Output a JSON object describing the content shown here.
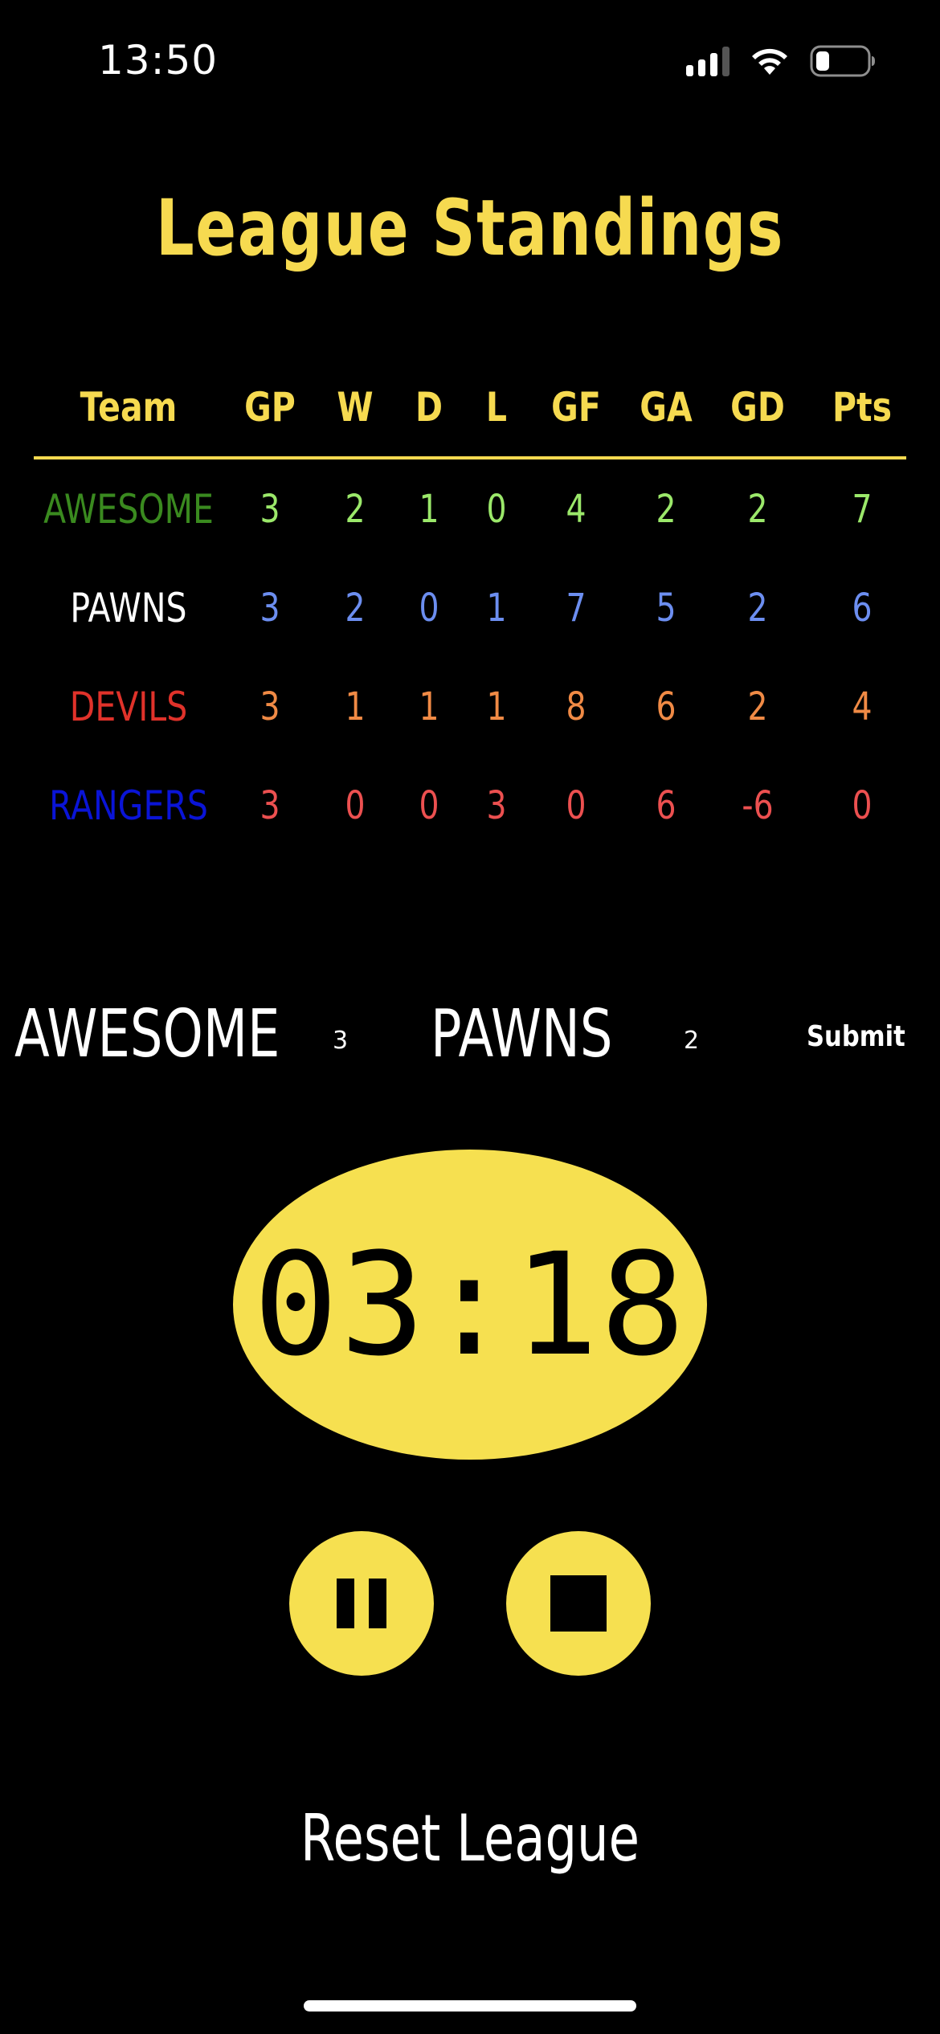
{
  "status_bar": {
    "time": "13:50",
    "icons": [
      "cellular-signal-icon",
      "wifi-icon",
      "battery-icon"
    ]
  },
  "page": {
    "title": "League Standings"
  },
  "standings": {
    "headers": {
      "team": "Team",
      "gp": "GP",
      "w": "W",
      "d": "D",
      "l": "L",
      "gf": "GF",
      "ga": "GA",
      "gd": "GD",
      "pts": "Pts"
    },
    "accent_color": "#f6da50",
    "rows": [
      {
        "team": "AWESOME",
        "gp": "3",
        "w": "2",
        "d": "1",
        "l": "0",
        "gf": "4",
        "ga": "2",
        "gd": "2",
        "pts": "7",
        "team_color": "#3a8a1f",
        "stat_color": "#9be86a"
      },
      {
        "team": "PAWNS",
        "gp": "3",
        "w": "2",
        "d": "0",
        "l": "1",
        "gf": "7",
        "ga": "5",
        "gd": "2",
        "pts": "6",
        "team_color": "#ffffff",
        "stat_color": "#6c8ef0"
      },
      {
        "team": "DEVILS",
        "gp": "3",
        "w": "1",
        "d": "1",
        "l": "1",
        "gf": "8",
        "ga": "6",
        "gd": "2",
        "pts": "4",
        "team_color": "#e0322a",
        "stat_color": "#f08a45"
      },
      {
        "team": "RANGERS",
        "gp": "3",
        "w": "0",
        "d": "0",
        "l": "3",
        "gf": "0",
        "ga": "6",
        "gd": "-6",
        "pts": "0",
        "team_color": "#0a14d6",
        "stat_color": "#ec5050"
      }
    ]
  },
  "match": {
    "home_team": "AWESOME",
    "home_score": "3",
    "away_team": "PAWNS",
    "away_score": "2",
    "submit_label": "Submit"
  },
  "timer": {
    "display": "03:18",
    "color": "#f6e050",
    "pause_icon": "pause-icon",
    "stop_icon": "stop-icon"
  },
  "actions": {
    "reset_label": "Reset League"
  }
}
